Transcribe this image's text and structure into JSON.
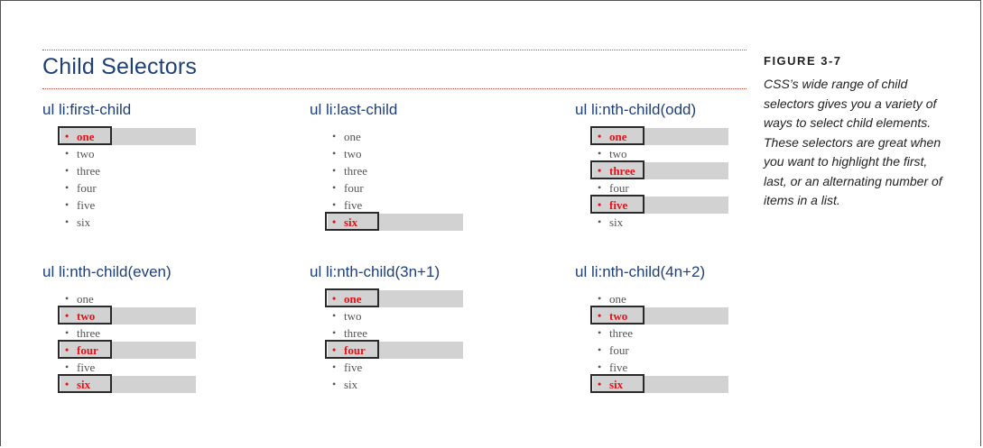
{
  "main_title": "Child Selectors",
  "figure": {
    "label": "FIGURE 3-7",
    "caption": "CSS’s wide range of child selectors gives you a variety of ways to select child elements. These selectors are great when you want to highlight the first, last, or an alternating number of items in a list."
  },
  "examples": [
    {
      "title": "ul li:first-child",
      "items": [
        "one",
        "two",
        "three",
        "four",
        "five",
        "six"
      ],
      "highlighted": [
        0
      ]
    },
    {
      "title": "ul li:last-child",
      "items": [
        "one",
        "two",
        "three",
        "four",
        "five",
        "six"
      ],
      "highlighted": [
        5
      ]
    },
    {
      "title": "ul li:nth-child(odd)",
      "items": [
        "one",
        "two",
        "three",
        "four",
        "five",
        "six"
      ],
      "highlighted": [
        0,
        2,
        4
      ]
    },
    {
      "title": "ul li:nth-child(even)",
      "items": [
        "one",
        "two",
        "three",
        "four",
        "five",
        "six"
      ],
      "highlighted": [
        1,
        3,
        5
      ]
    },
    {
      "title": "ul li:nth-child(3n+1)",
      "items": [
        "one",
        "two",
        "three",
        "four",
        "five",
        "six"
      ],
      "highlighted": [
        0,
        3
      ]
    },
    {
      "title": "ul li:nth-child(4n+2)",
      "items": [
        "one",
        "two",
        "three",
        "four",
        "five",
        "six"
      ],
      "highlighted": [
        1,
        5
      ]
    }
  ],
  "colors": {
    "title_blue": "#1f3f77",
    "highlight_red": "#e3131b",
    "highlight_bg": "#d2d2d2",
    "rule_red": "#c0504d"
  }
}
